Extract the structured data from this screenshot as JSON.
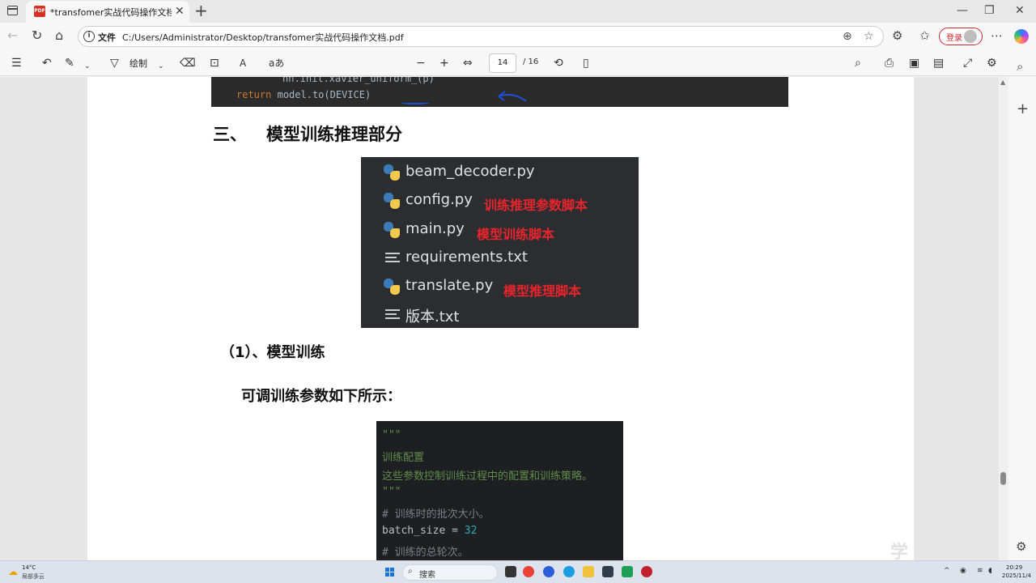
{
  "browser": {
    "tab_title": "*transfomer实战代码操作文档.pdf",
    "pdf_badge": "PDF",
    "file_label": "文件",
    "url": "C:/Users/Administrator/Desktop/transfomer实战代码操作文档.pdf",
    "login_label": "登录"
  },
  "pdf_toolbar": {
    "draw_label": "绘制",
    "read_aloud_label": "aあ",
    "page_current": "14",
    "page_total": "/ 16"
  },
  "document": {
    "code_top": {
      "line1": "nn.init.xavier_uniform_(p)",
      "keyword": "return",
      "expr": "model.to(DEVICE)"
    },
    "section_number": "三、",
    "section_title": "模型训练推理部分",
    "files": [
      {
        "icon": "python-icon",
        "name": "beam_decoder.py",
        "note": ""
      },
      {
        "icon": "python-icon",
        "name": "config.py",
        "note": "训练推理参数脚本"
      },
      {
        "icon": "python-icon",
        "name": "main.py",
        "note": "模型训练脚本"
      },
      {
        "icon": "text-file-icon",
        "name": "requirements.txt",
        "note": ""
      },
      {
        "icon": "python-icon",
        "name": "translate.py",
        "note": "模型推理脚本"
      },
      {
        "icon": "text-file-icon",
        "name": "版本.txt",
        "note": ""
      }
    ],
    "subsection_title": "（1）、模型训练",
    "params_intro": "可调训练参数如下所示：",
    "code_config": {
      "docstring_open": "\"\"\"",
      "doc_line1": "训练配置",
      "doc_line2": "这些参数控制训练过程中的配置和训练策略。",
      "docstring_close": "\"\"\"",
      "comment1": "# 训练时的批次大小。",
      "assign_var": "batch_size = ",
      "assign_val": "32",
      "comment2": "# 训练的总轮次。"
    }
  },
  "watermark": "学",
  "taskbar": {
    "weather_temp": "14°C",
    "weather_desc": "局部多云",
    "search_label": "搜索",
    "time": "20:29",
    "date": "2025/11/4"
  },
  "colors": {
    "accent_red": "#e8242c",
    "annotation_blue": "#1e4fd8",
    "login_red": "#c9272d"
  }
}
